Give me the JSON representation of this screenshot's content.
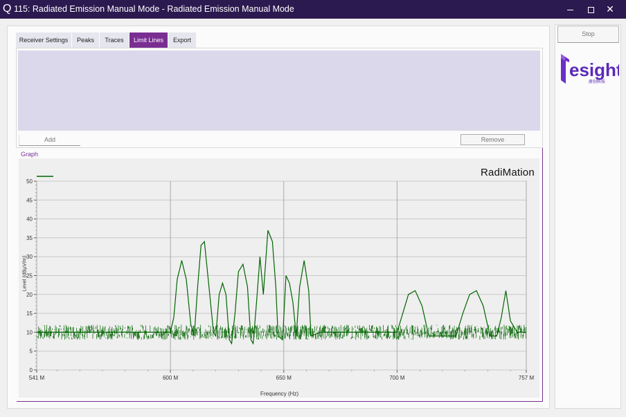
{
  "window": {
    "title": "115: Radiated Emission Manual Mode - Radiated Emission Manual Mode",
    "app_icon": "Q",
    "close_glyph": "✕"
  },
  "tabs": [
    {
      "label": "Receiver Settings",
      "active": false
    },
    {
      "label": "Peaks",
      "active": false
    },
    {
      "label": "Traces",
      "active": false
    },
    {
      "label": "Limit Lines",
      "active": true
    },
    {
      "label": "Export",
      "active": false
    }
  ],
  "limit_lines": {
    "add_label": "Add",
    "remove_label": "Remove"
  },
  "graph": {
    "group_label": "Graph",
    "brand": "RadiMation"
  },
  "side": {
    "stop_label": "Stop",
    "logo_text": "esight",
    "logo_sub": "原创科技"
  },
  "colors": {
    "titlebar": "#2b1a50",
    "accent": "#7a2e92",
    "trace": "#006400",
    "limit_area": "#dcd8ec"
  },
  "chart_data": {
    "type": "line",
    "xlabel": "Frequency (Hz)",
    "ylabel": "Level (dBµV/m)",
    "xlim": [
      541,
      757
    ],
    "ylim": [
      0,
      50
    ],
    "x_tick_labels": [
      "541 M",
      "600 M",
      "650 M",
      "700 M",
      "757 M"
    ],
    "x_tick_values": [
      541,
      600,
      650,
      700,
      757
    ],
    "y_ticks": [
      0,
      5,
      10,
      15,
      20,
      25,
      30,
      35,
      40,
      45,
      50
    ],
    "grid": true,
    "series": [
      {
        "color": "#006400",
        "noise_floor": [
          8,
          12
        ],
        "x": [
          541,
          561,
          581,
          600,
          601.5,
          603,
          605,
          607,
          609,
          610.5,
          612,
          613.5,
          615,
          617,
          619,
          620,
          621.5,
          623,
          624.5,
          626,
          627,
          628.5,
          630,
          632,
          634,
          635.5,
          636.5,
          638,
          639.5,
          641,
          643,
          645,
          646.5,
          647.5,
          649.5,
          651,
          652.5,
          654,
          655.5,
          657,
          659,
          661,
          662,
          666,
          680,
          694,
          700,
          702,
          705,
          708,
          711,
          714,
          726,
          729,
          732,
          735,
          738,
          741,
          744,
          746,
          748,
          750,
          753,
          757
        ],
        "y": [
          10,
          10,
          10,
          10,
          14,
          24,
          29,
          24,
          12,
          9,
          22,
          33,
          34,
          22,
          10,
          9,
          20,
          23,
          20,
          8,
          7,
          15,
          26,
          28,
          22,
          8,
          7,
          18,
          30,
          20,
          37,
          34,
          22,
          9,
          8,
          25,
          23,
          18,
          9,
          22,
          29,
          21,
          9,
          10,
          10,
          10,
          10,
          14,
          20,
          21,
          17,
          9,
          9,
          15,
          20,
          21,
          17,
          9,
          9,
          14,
          21,
          13,
          10,
          10
        ]
      }
    ]
  }
}
